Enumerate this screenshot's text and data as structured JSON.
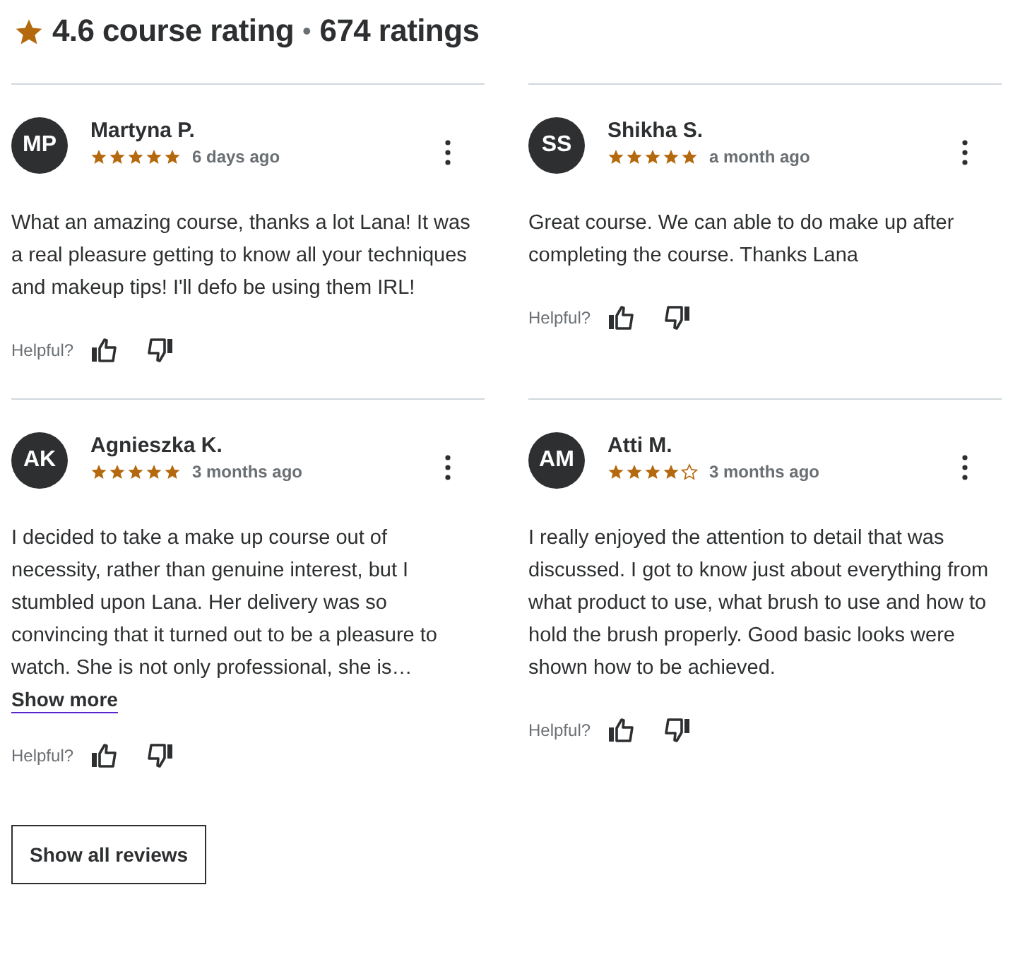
{
  "header": {
    "rating": "4.6 course rating",
    "separator": "•",
    "count": "674 ratings"
  },
  "reviews": [
    {
      "initials": "MP",
      "name": "Martyna P.",
      "stars": 5,
      "time": "6 days ago",
      "text": "What an amazing course, thanks a lot Lana! It was a real pleasure getting to know all your techniques and makeup tips! I'll defo be using them IRL!",
      "helpful": "Helpful?"
    },
    {
      "initials": "SS",
      "name": "Shikha S.",
      "stars": 5,
      "time": "a month ago",
      "text": "Great course. We can able to do make up after completing the course. Thanks Lana",
      "helpful": "Helpful?"
    },
    {
      "initials": "AK",
      "name": "Agnieszka K.",
      "stars": 5,
      "time": "3 months ago",
      "text": "I decided to take a make up course out of necessity, rather than genuine interest, but I stumbled upon Lana. Her delivery was so convincing that it turned out to be a pleasure to watch. She is not only professional, she is…",
      "show_more": "Show more",
      "helpful": "Helpful?"
    },
    {
      "initials": "AM",
      "name": "Atti M.",
      "stars": 4,
      "time": "3 months ago",
      "text": "I really enjoyed the attention to detail that was discussed. I got to know just about everything from what product to use, what brush to use and how to hold the brush properly. Good basic looks were shown how to be achieved.",
      "helpful": "Helpful?"
    }
  ],
  "show_all": "Show all reviews"
}
